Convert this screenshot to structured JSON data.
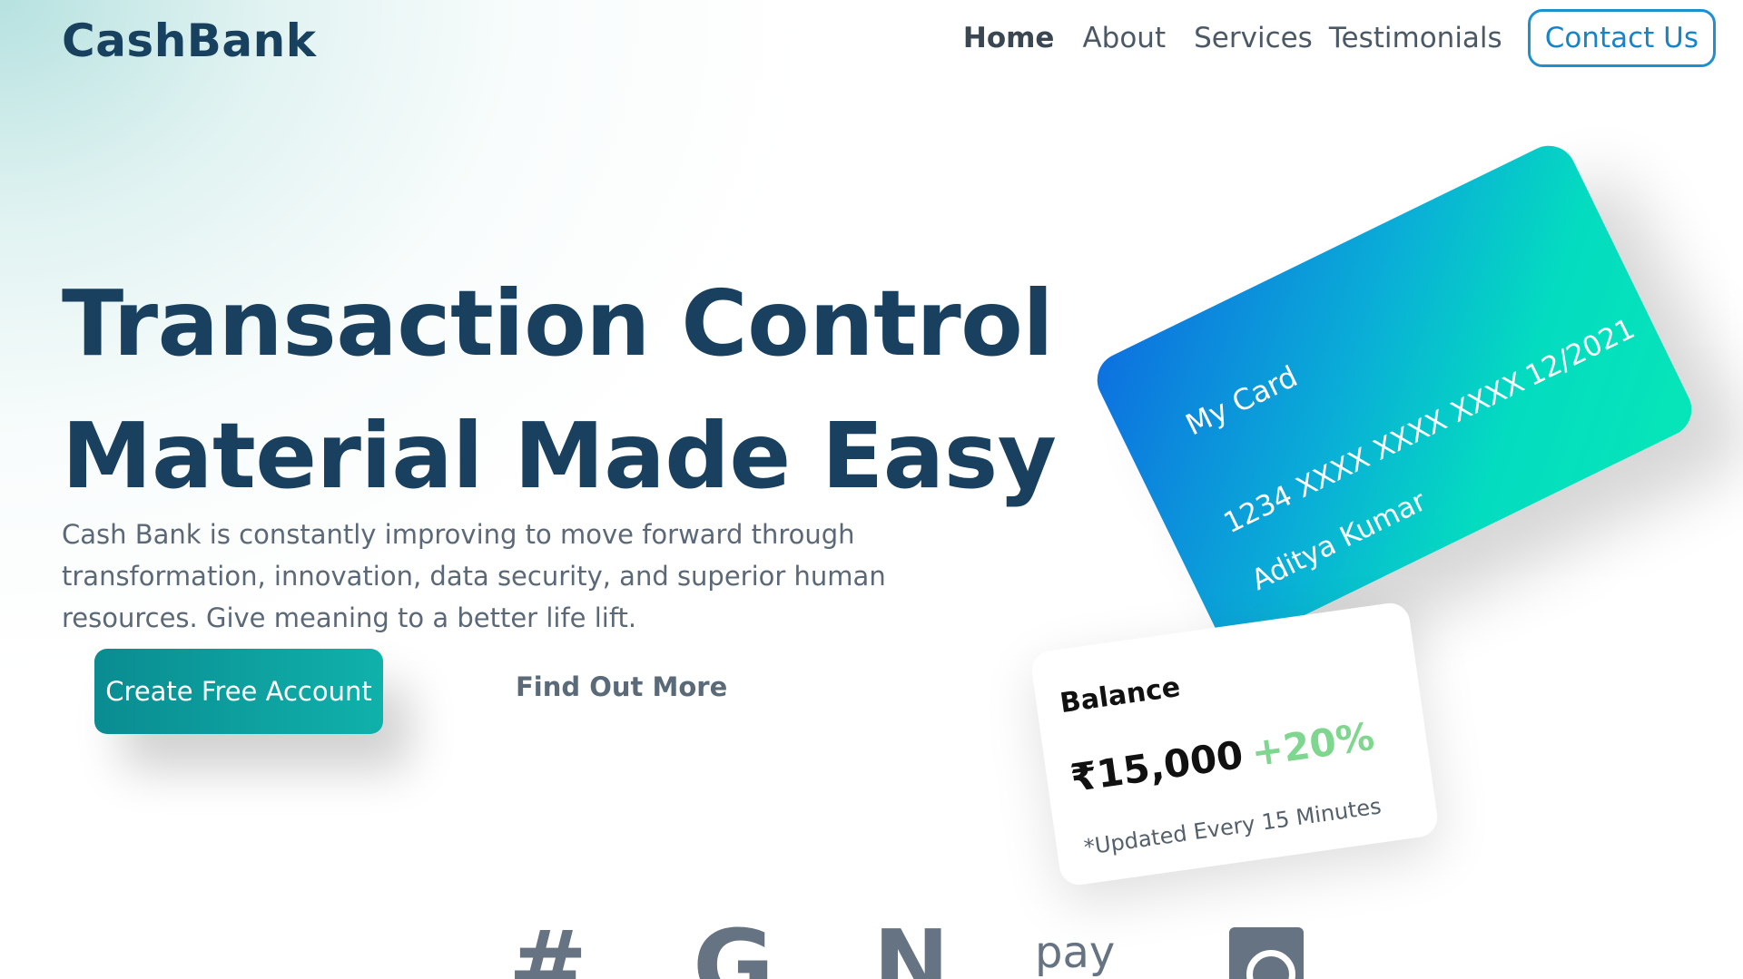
{
  "brand": {
    "name": "CashBank"
  },
  "nav": {
    "items": [
      "Home",
      "About",
      "Services",
      "Testimonials"
    ],
    "active": "Home",
    "contact_label": "Contact Us"
  },
  "hero": {
    "title_line1": "Transaction Control",
    "title_line2": "Material Made Easy",
    "description": "Cash Bank is constantly improving to move forward through transformation, innovation, data security, and superior human resources. Give meaning to a better life lift.",
    "primary_cta": "Create Free Account",
    "secondary_cta": "Find Out More"
  },
  "card": {
    "label": "My Card",
    "number": "1234 XXXX XXXX XXXX",
    "expiry": "12/2021",
    "holder": "Aditya Kumar"
  },
  "balance": {
    "title": "Balance",
    "amount": "₹15,000",
    "change": "+20%",
    "note": "*Updated Every 15 Minutes"
  },
  "partners": {
    "icons": [
      "slack-hash-icon",
      "google-g-icon",
      "n-logo-icon",
      "pay-logo-icon",
      "square-logo-icon"
    ],
    "pay_text": "pay"
  },
  "colors": {
    "brand_dark": "#17415f",
    "accent_teal": "#10b1ab",
    "contact_blue": "#1e8fd1",
    "positive_green": "#7fd68e"
  }
}
